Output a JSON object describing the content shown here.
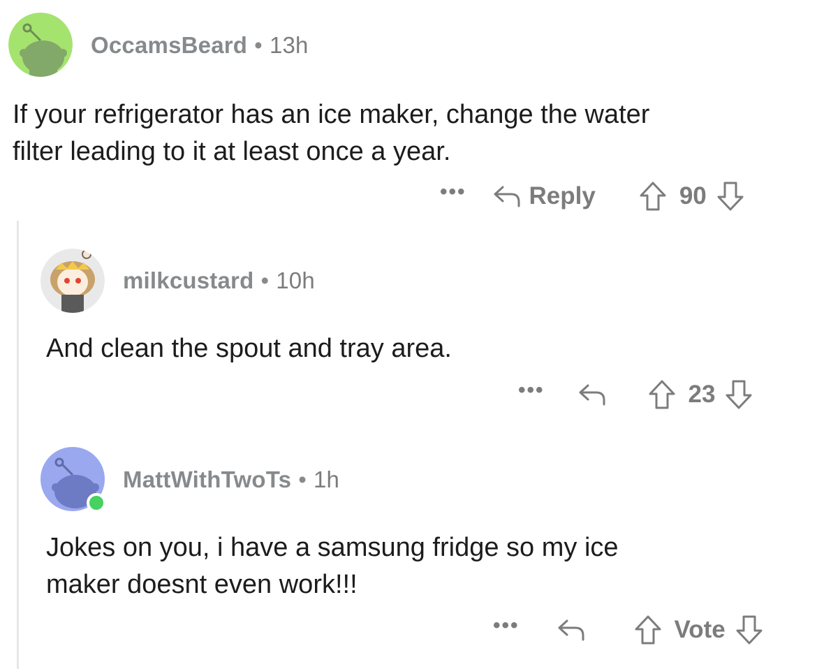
{
  "comments": [
    {
      "username": "OccamsBeard",
      "separator": "•",
      "time": "13h",
      "body": "If your refrigerator has an ice maker, change the water\nfilter leading to it at least once a year.",
      "more": "•••",
      "reply_label": "Reply",
      "vote_count": "90",
      "avatar_color": "#a5e36f"
    },
    {
      "username": "milkcustard",
      "separator": "•",
      "time": "10h",
      "body": "And clean the spout and tray area.",
      "more": "•••",
      "vote_count": "23",
      "avatar_color": "#e9e9ea"
    },
    {
      "username": "MattWithTwoTs",
      "separator": "•",
      "time": "1h",
      "body": "Jokes on you, i have a samsung fridge so my ice\nmaker doesnt even work!!!",
      "more": "•••",
      "vote_count": "Vote",
      "avatar_color": "#9aa8f0",
      "online_color": "#46d160"
    }
  ],
  "icons": {
    "reply": "reply-arrow-icon",
    "upvote": "upvote-arrow-icon",
    "downvote": "downvote-arrow-icon",
    "more": "more-options-icon",
    "avatar": "snoo-avatar-icon"
  }
}
